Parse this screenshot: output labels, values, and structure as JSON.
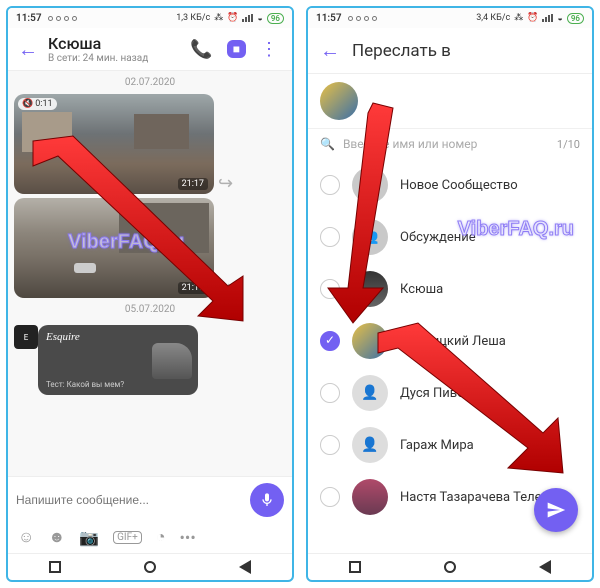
{
  "left": {
    "status": {
      "time": "11:57",
      "net": "1,3 КБ/с",
      "battery": "96"
    },
    "header": {
      "name": "Ксюша",
      "presence": "В сети: 24 мин. назад"
    },
    "dates": {
      "d1": "02.07.2020",
      "d2": "05.07.2020"
    },
    "media1": {
      "duration": "0:11",
      "ts": "21:17"
    },
    "media2": {
      "ts": "21:17"
    },
    "esquire": {
      "brand": "Esquire",
      "caption": "Тест: Какой вы мем?"
    },
    "input": {
      "placeholder": "Напишите сообщение..."
    },
    "icons": {
      "gif": "GIF+",
      "more": "•••"
    }
  },
  "right": {
    "status": {
      "time": "11:57",
      "net": "3,4 КБ/с",
      "battery": "96"
    },
    "title": "Переслать в",
    "search": {
      "placeholder": "Введите имя или номер",
      "count": "1/10"
    },
    "contacts": [
      {
        "name": "Новое Сообщество"
      },
      {
        "name": "Обсуждение"
      },
      {
        "name": "Ксюша"
      },
      {
        "name": "Липницкий Леша"
      },
      {
        "name": "Дуся Пиво"
      },
      {
        "name": "Гараж Мира"
      },
      {
        "name": "Настя Тазарачева Теле2"
      }
    ]
  },
  "watermark": "ViberFAQ.ru"
}
